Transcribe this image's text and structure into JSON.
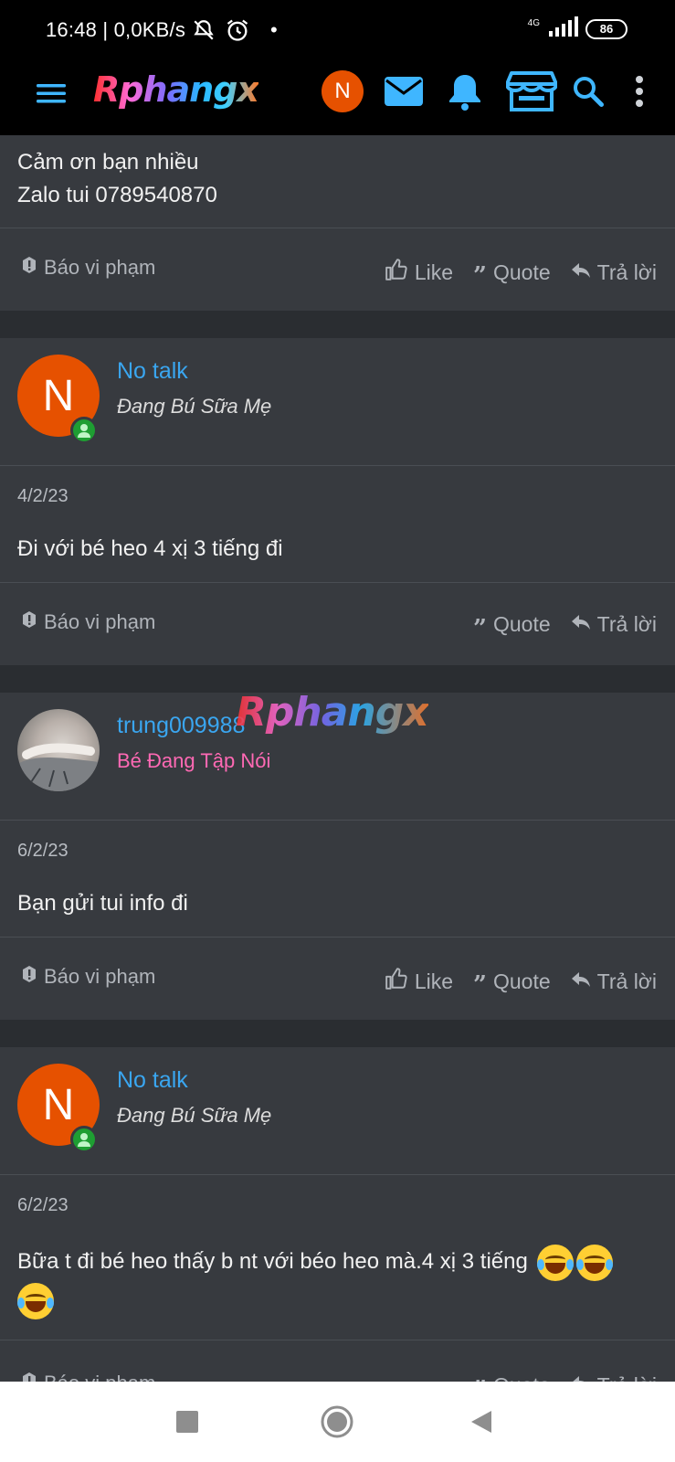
{
  "status_bar": {
    "time": "16:48 | 0,0KB/s",
    "network": "4G",
    "battery": "86"
  },
  "header": {
    "logo": "Rphangx",
    "avatar_letter": "N",
    "icons": [
      "menu-icon",
      "mail-icon",
      "bell-icon",
      "store-icon",
      "search-icon",
      "more-vert-icon"
    ]
  },
  "top_post": {
    "body_line1": "Cảm ơn bạn nhiều",
    "body_line2": "Zalo tui 0789540870",
    "report": "Báo vi phạm",
    "like": "Like",
    "quote": "Quote",
    "reply": "Trả lời"
  },
  "posts": [
    {
      "avatar_letter": "N",
      "username": "No talk",
      "user_title": "Đang Bú Sữa Mẹ",
      "date": "4/2/23",
      "body": "Đi với bé heo 4 xị 3 tiếng đi",
      "report": "Báo vi phạm",
      "quote": "Quote",
      "reply": "Trả lời"
    },
    {
      "username": "trung009988",
      "user_title": "Bé Đang Tập Nói",
      "date": "6/2/23",
      "body": "Bạn gửi tui info đi",
      "report": "Báo vi phạm",
      "like": "Like",
      "quote": "Quote",
      "reply": "Trả lời"
    },
    {
      "avatar_letter": "N",
      "username": "No talk",
      "user_title": "Đang Bú Sữa Mẹ",
      "date": "6/2/23",
      "body": "Bữa t đi bé heo thấy b nt với béo heo mà.4 xị 3 tiếng",
      "report": "Báo vi phạm",
      "quote": "Quote",
      "reply": "Trả lời"
    }
  ],
  "watermark": "Rphangx",
  "colors": {
    "username": "#3aa6f0",
    "avatar": "#e65100",
    "online": "#1e9e32",
    "rank_pink": "#ff69b4",
    "header_icon": "#3fb6ff"
  }
}
